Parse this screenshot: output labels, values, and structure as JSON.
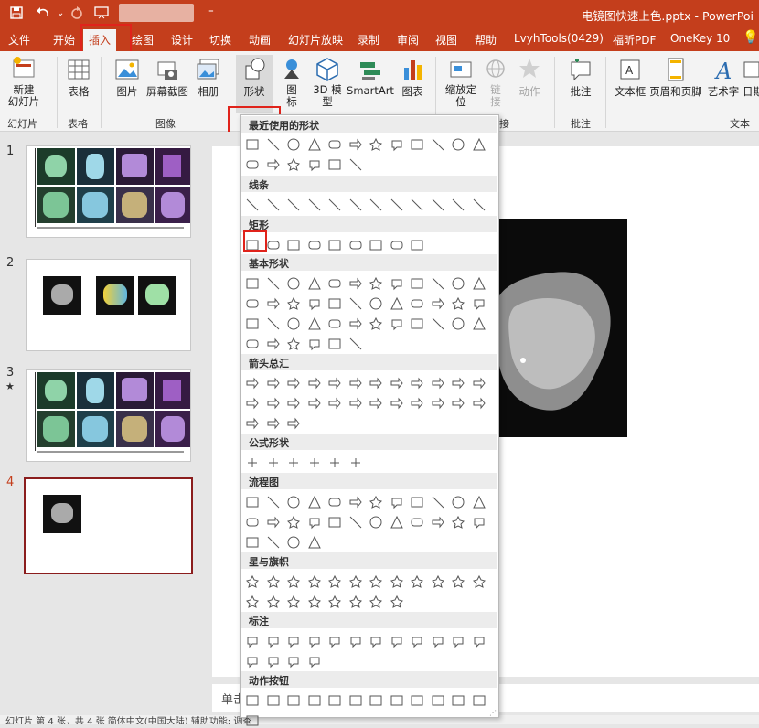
{
  "title_bar": {
    "doc_title": "电镜图快速上色.pptx - PowerPoi",
    "qa_icons": [
      "save-icon",
      "undo-icon",
      "redo-icon",
      "present-icon",
      "customize-icon"
    ]
  },
  "tabs": [
    {
      "label": "文件"
    },
    {
      "label": "开始"
    },
    {
      "label": "插入",
      "active": true
    },
    {
      "label": "绘图"
    },
    {
      "label": "设计"
    },
    {
      "label": "切换"
    },
    {
      "label": "动画"
    },
    {
      "label": "幻灯片放映"
    },
    {
      "label": "录制"
    },
    {
      "label": "审阅"
    },
    {
      "label": "视图"
    },
    {
      "label": "帮助"
    },
    {
      "label": "LvyhTools(0429)"
    },
    {
      "label": "福昕PDF"
    },
    {
      "label": "OneKey 10"
    }
  ],
  "ribbon": {
    "tools": {
      "new_slide": "新建\n幻灯片",
      "table": "表格",
      "picture": "图片",
      "screenshot": "屏幕截图",
      "album": "相册",
      "shapes": "形状",
      "icons": "图\n标",
      "model3d": "3D 模\n型",
      "smartart": "SmartArt",
      "chart": "图表",
      "zoom": "缩放定\n位",
      "link": "链\n接",
      "action": "动作",
      "comment": "批注",
      "textbox": "文本框",
      "header_footer": "页眉和页脚",
      "wordart": "艺术字",
      "datetime": "日期"
    },
    "groups": {
      "slides": "幻灯片",
      "tables": "表格",
      "images": "图像",
      "links": "接",
      "comments": "批注",
      "text": "文本"
    }
  },
  "slides": [
    {
      "number": "1",
      "marker": ""
    },
    {
      "number": "2",
      "marker": ""
    },
    {
      "number": "3",
      "marker": "★"
    },
    {
      "number": "4",
      "marker": "",
      "selected": true
    }
  ],
  "gallery": {
    "categories": [
      {
        "label": "最近使用的形状",
        "count": 18
      },
      {
        "label": "线条",
        "count": 12
      },
      {
        "label": "矩形",
        "count": 9
      },
      {
        "label": "基本形状",
        "count": 42
      },
      {
        "label": "箭头总汇",
        "count": 27
      },
      {
        "label": "公式形状",
        "count": 6
      },
      {
        "label": "流程图",
        "count": 28
      },
      {
        "label": "星与旗帜",
        "count": 20
      },
      {
        "label": "标注",
        "count": 16
      },
      {
        "label": "动作按钮",
        "count": 13
      }
    ]
  },
  "notes_text": "单击",
  "status_text": "幻灯片 第 4 张，共 4 张     简体中文(中国大陆)     辅助功能: 调查",
  "colors": {
    "accent": "#c43e1c",
    "highlight": "#e0231b",
    "selected_slide_border": "#8b1d1d"
  }
}
